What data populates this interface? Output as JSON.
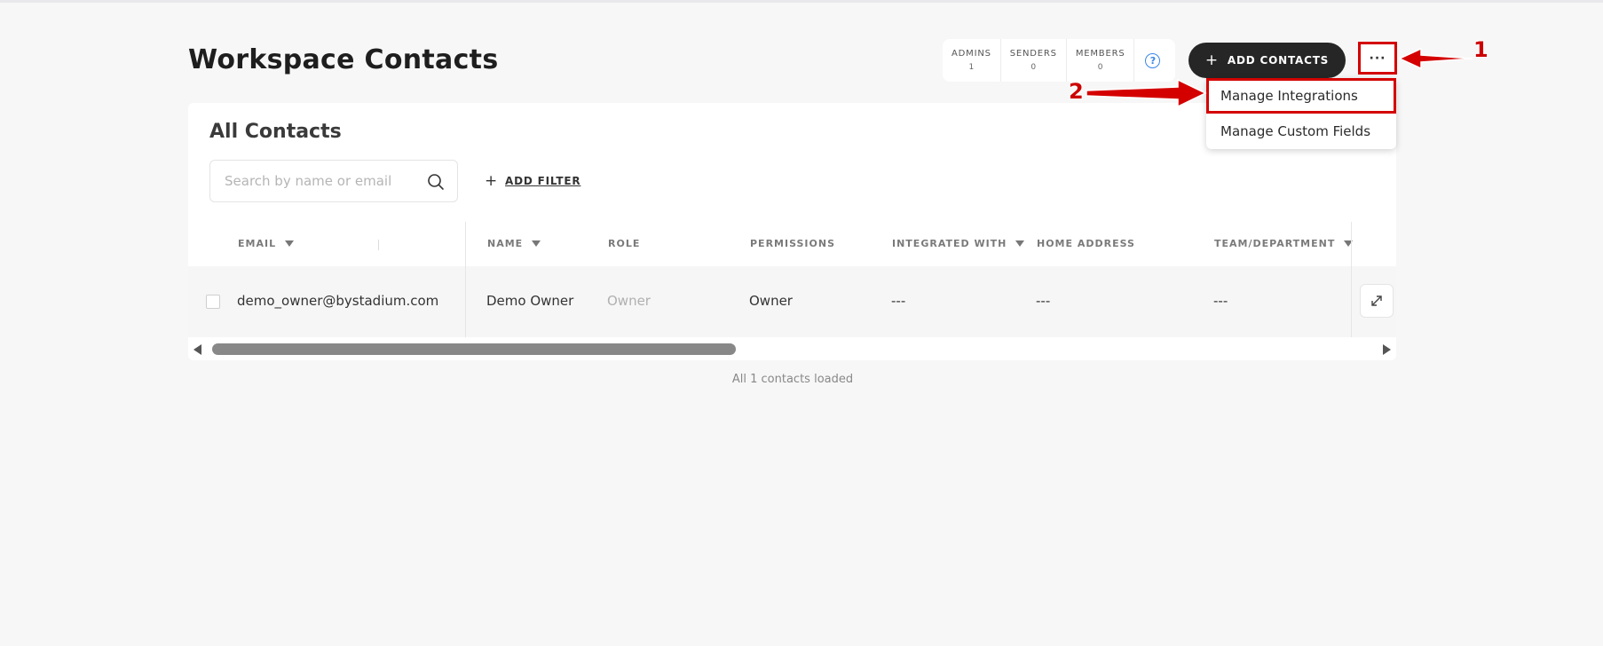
{
  "page": {
    "title": "Workspace Contacts"
  },
  "stats": [
    {
      "label": "ADMINS",
      "value": "1"
    },
    {
      "label": "SENDERS",
      "value": "0"
    },
    {
      "label": "MEMBERS",
      "value": "0"
    }
  ],
  "header": {
    "add_contacts_label": "ADD CONTACTS",
    "more_label": "···",
    "help_glyph": "?"
  },
  "dropdown": {
    "items": [
      {
        "label": "Manage Integrations"
      },
      {
        "label": "Manage Custom Fields"
      }
    ]
  },
  "card": {
    "title": "All Contacts",
    "search_placeholder": "Search by name or email",
    "add_filter_label": "ADD FILTER"
  },
  "table": {
    "columns": [
      {
        "label": "EMAIL",
        "sortable": true
      },
      {
        "label": "NAME",
        "sortable": true
      },
      {
        "label": "ROLE",
        "sortable": false
      },
      {
        "label": "PERMISSIONS",
        "sortable": false
      },
      {
        "label": "INTEGRATED WITH",
        "sortable": true
      },
      {
        "label": "HOME ADDRESS",
        "sortable": false
      },
      {
        "label": "TEAM/DEPARTMENT",
        "sortable": true
      }
    ],
    "rows": [
      {
        "email": "demo_owner@bystadium.com",
        "name": "Demo Owner",
        "role": "Owner",
        "permissions": "Owner",
        "integrated_with": "---",
        "home_address": "---",
        "team_department": "---"
      }
    ]
  },
  "footer": {
    "loaded_note": "All 1 contacts loaded"
  },
  "annotations": {
    "step1": "1",
    "step2": "2"
  },
  "colors": {
    "annotation": "#d40000",
    "primary_button": "#262626",
    "help": "#3a86e8"
  },
  "icons": [
    "search-icon",
    "expand-icon",
    "help-icon",
    "plus-icon",
    "caret-down-icon"
  ]
}
